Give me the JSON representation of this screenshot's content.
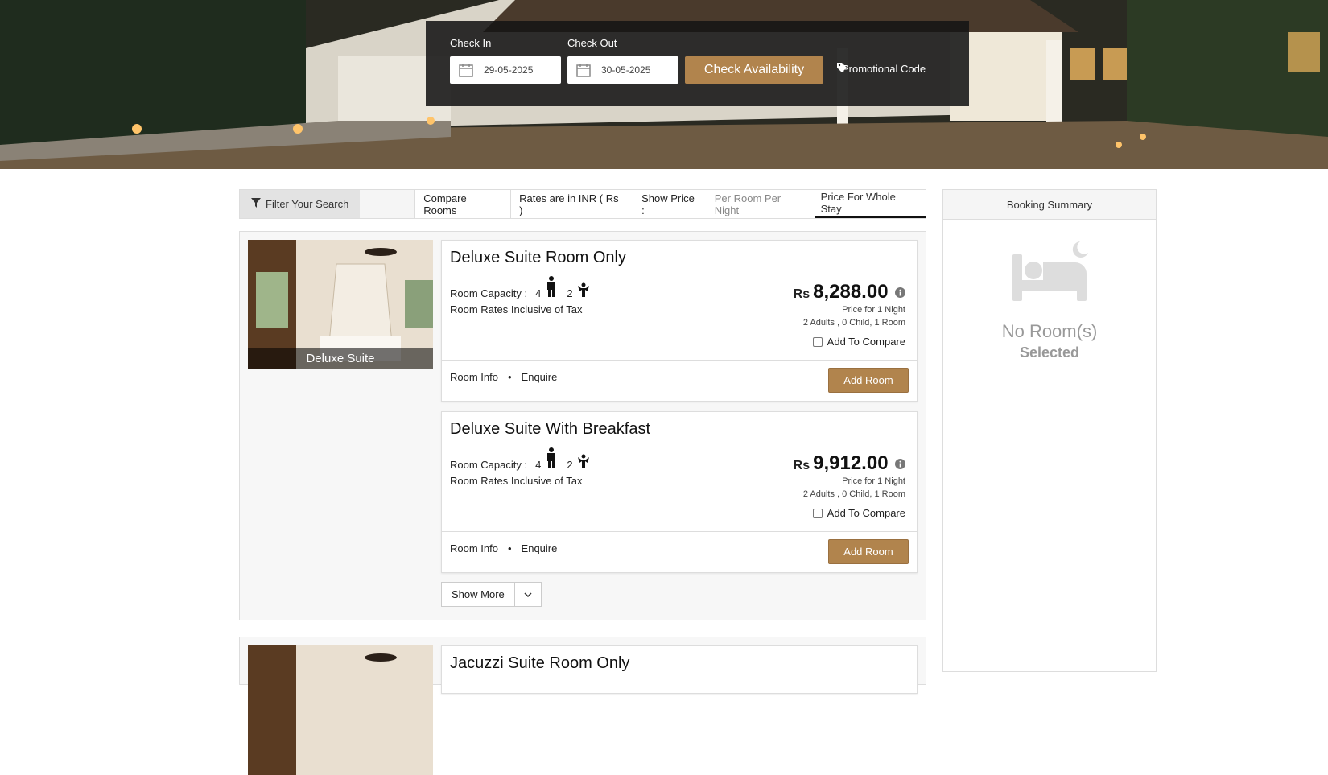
{
  "search": {
    "check_in_label": "Check In",
    "check_out_label": "Check Out",
    "check_in_value": "29-05-2025",
    "check_out_value": "30-05-2025",
    "check_button": "Check Availability",
    "promo_label": "Promotional Code"
  },
  "filterbar": {
    "filter_label": "Filter Your Search",
    "compare_rooms": "Compare Rooms",
    "rates_in": "Rates are in INR ( Rs )",
    "show_price": "Show Price :",
    "per_room_per_night": "Per Room Per Night",
    "price_whole_stay": "Price For Whole Stay"
  },
  "room_types": [
    {
      "thumb_caption": "Deluxe Suite",
      "rates": [
        {
          "title": "Deluxe Suite Room Only",
          "capacity_label": "Room Capacity :",
          "adults": "4",
          "children": "2",
          "tax_note": "Room Rates Inclusive of Tax",
          "currency": "Rs",
          "price": "8,288.00",
          "price_for": "Price for 1 Night",
          "occupancy": "2 Adults , 0 Child, 1 Room",
          "compare_label": "Add To Compare",
          "room_info": "Room Info",
          "enquire": "Enquire",
          "add_room": "Add Room"
        },
        {
          "title": "Deluxe Suite With Breakfast",
          "capacity_label": "Room Capacity :",
          "adults": "4",
          "children": "2",
          "tax_note": "Room Rates Inclusive of Tax",
          "currency": "Rs",
          "price": "9,912.00",
          "price_for": "Price for 1 Night",
          "occupancy": "2 Adults , 0 Child, 1 Room",
          "compare_label": "Add To Compare",
          "room_info": "Room Info",
          "enquire": "Enquire",
          "add_room": "Add Room"
        }
      ],
      "show_more": "Show More"
    },
    {
      "rates": [
        {
          "title": "Jacuzzi Suite Room Only"
        }
      ]
    }
  ],
  "summary": {
    "header": "Booking Summary",
    "empty_line1": "No Room(s)",
    "empty_line2": "Selected"
  },
  "colors": {
    "accent": "#b1844d",
    "search_bg": "#141414",
    "panel_bg": "#f7f7f7"
  },
  "icons": [
    "calendar-icon",
    "tag-icon",
    "filter-icon",
    "adult-icon",
    "child-icon",
    "info-icon",
    "chevron-down-icon",
    "bed-icon"
  ]
}
